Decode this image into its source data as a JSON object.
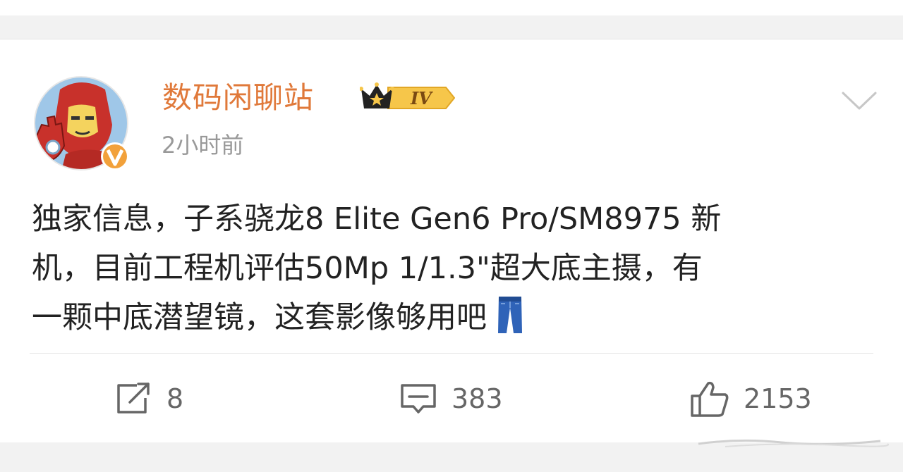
{
  "post": {
    "author": "数码闲聊站",
    "level_badge": "IV",
    "time": "2小时前",
    "content_lines": [
      "独家信息，子系骁龙8 Elite Gen6 Pro/SM8975 新",
      "机，目前工程机评估50Mp 1/1.3\"超大底主摄，有",
      "一颗中底潜望镜，这套影像够用吧"
    ],
    "emoji": "jeans-emoji",
    "verified_badge": "V"
  },
  "actions": {
    "repost_count": "8",
    "comment_count": "383",
    "like_count": "2153"
  },
  "colors": {
    "author": "#e0793a",
    "time": "#999999",
    "text": "#222222",
    "icon": "#666666",
    "background": "#f2f2f2"
  },
  "icons": [
    "share-icon",
    "comment-icon",
    "thumbs-up-icon",
    "chevron-down-icon",
    "crown-icon",
    "verified-icon"
  ]
}
